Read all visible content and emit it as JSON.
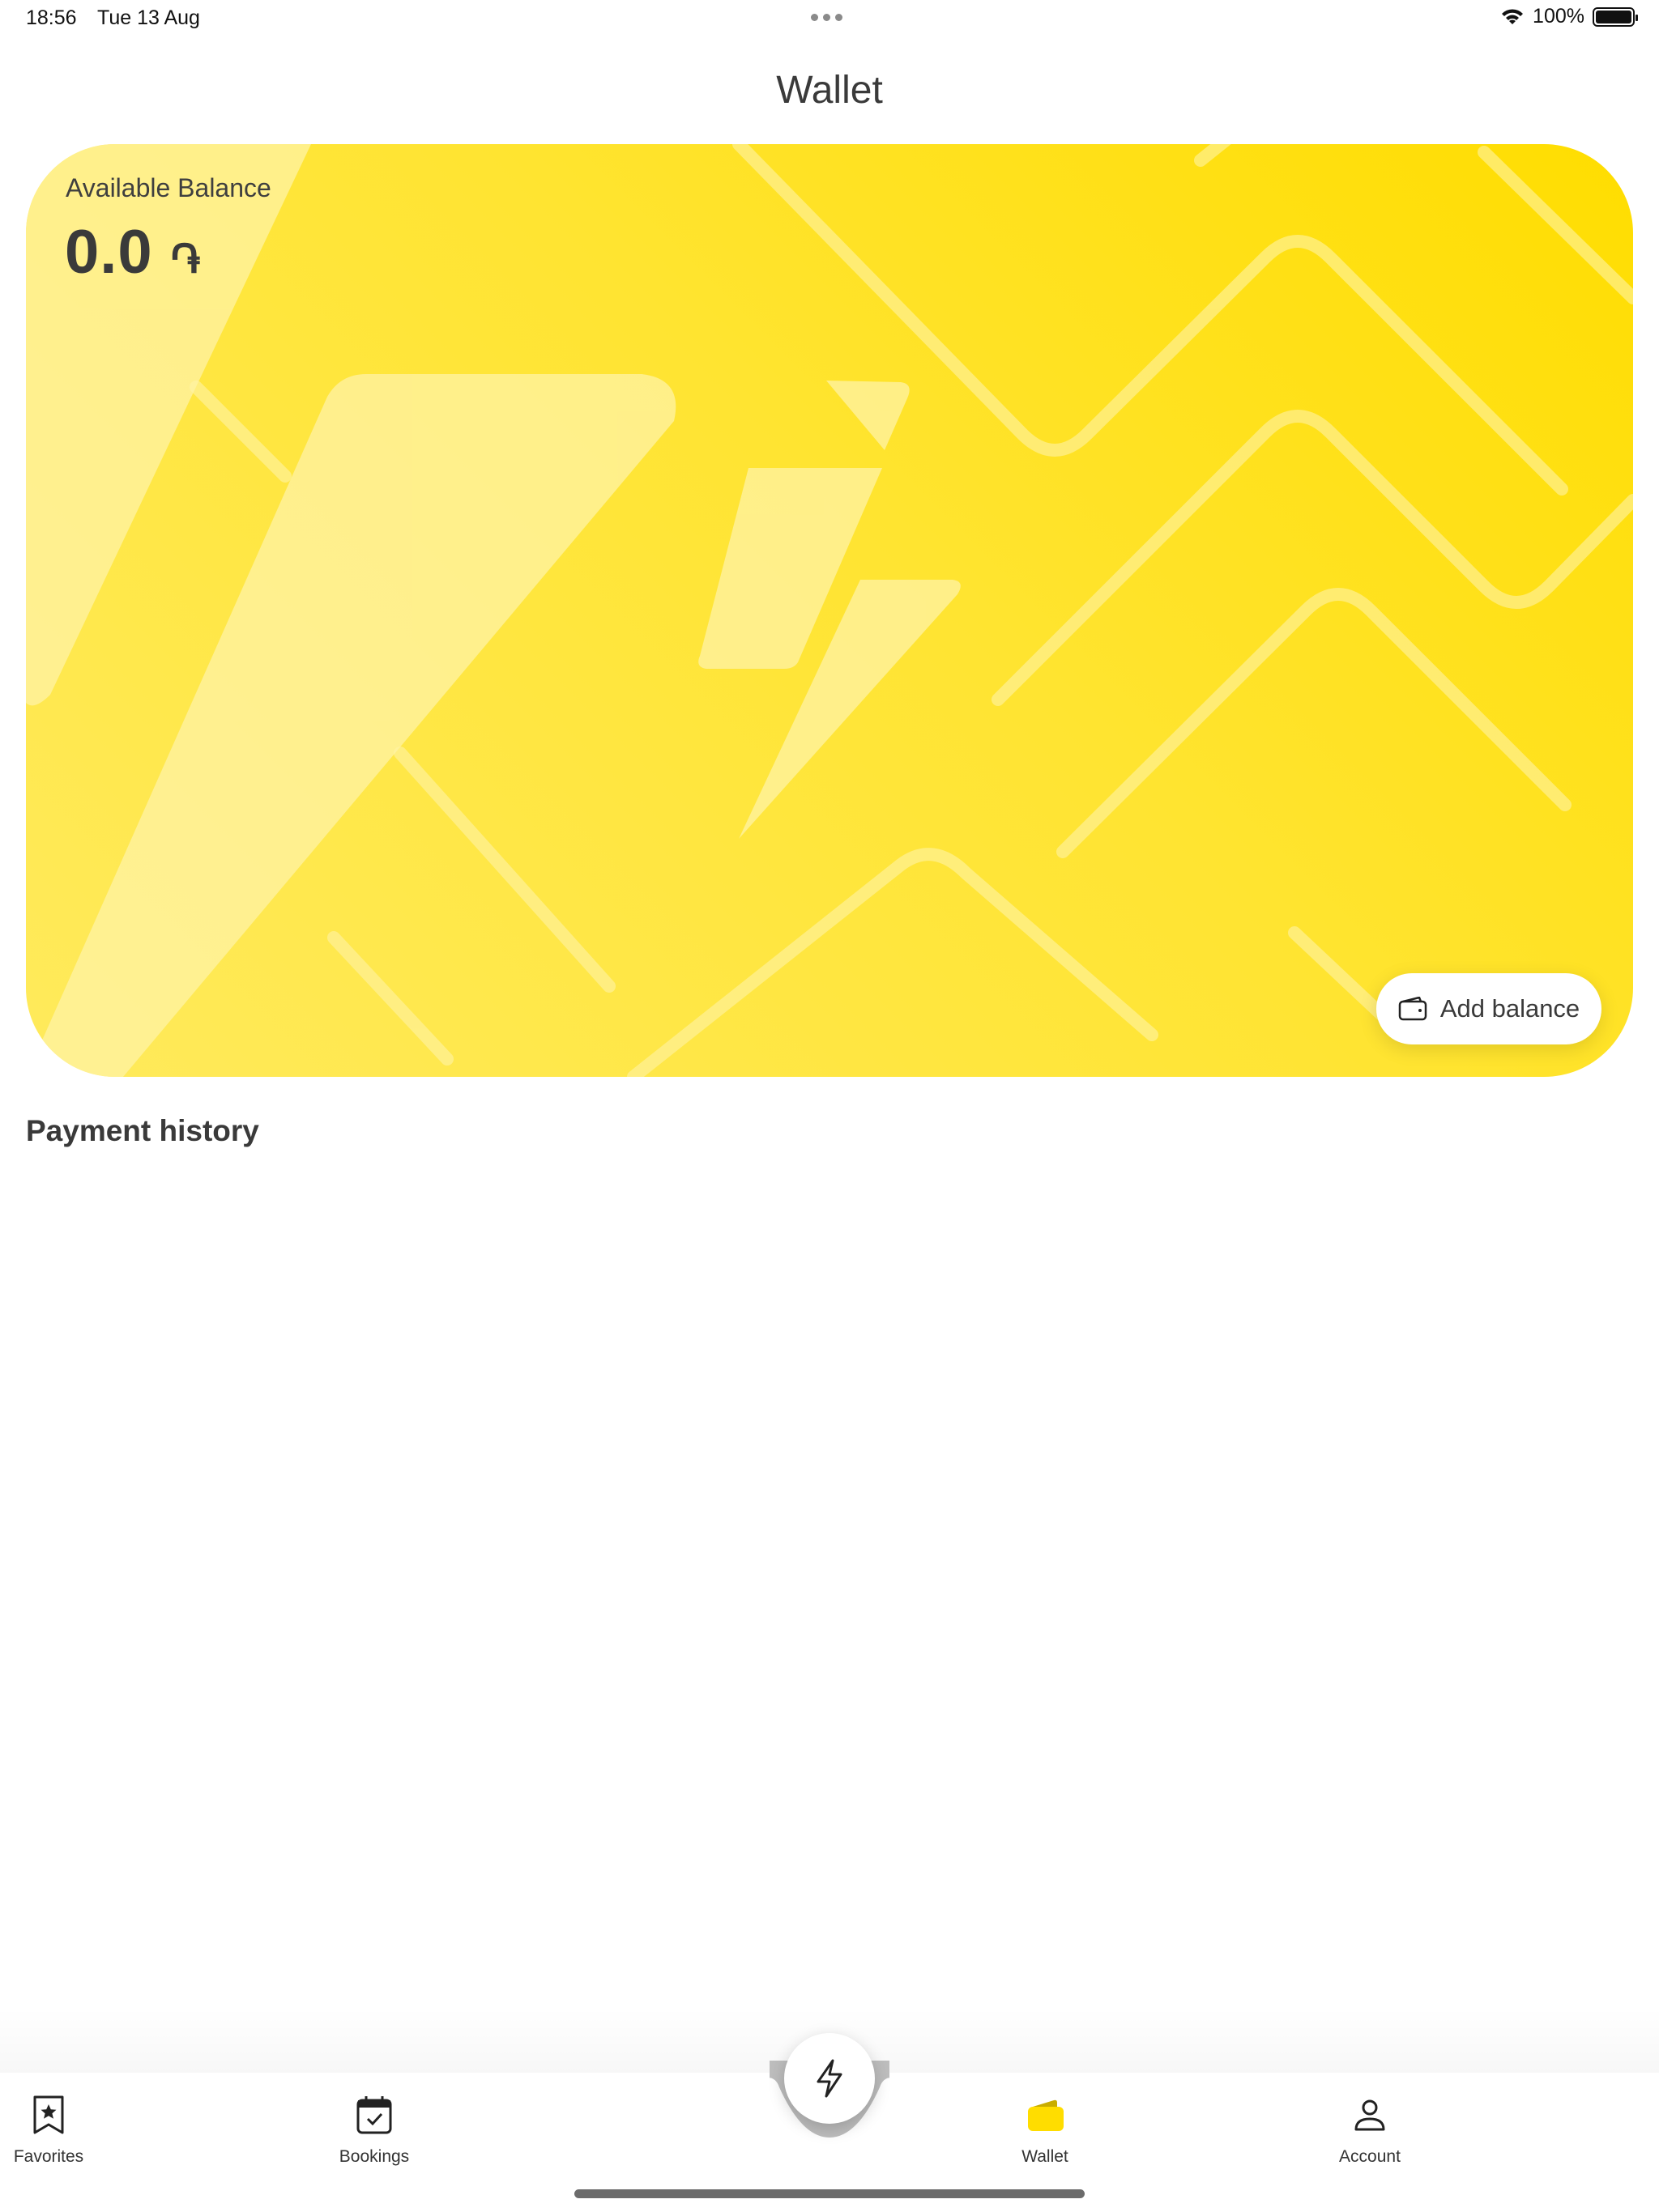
{
  "status_bar": {
    "time": "18:56",
    "date": "Tue 13 Aug",
    "battery": "100%"
  },
  "header": {
    "title": "Wallet"
  },
  "wallet_card": {
    "balance_label": "Available Balance",
    "balance_value": "0.0",
    "currency_symbol": "֏",
    "add_balance_label": "Add balance",
    "colors": {
      "card_start": "#ffea5c",
      "card_end": "#ffdd00",
      "pattern": "#fff3a6"
    }
  },
  "payment_history": {
    "title": "Payment history"
  },
  "tab_bar": {
    "items": [
      {
        "label": "Favorites",
        "icon": "bookmark-star-icon"
      },
      {
        "label": "Bookings",
        "icon": "calendar-check-icon"
      },
      {
        "label": "Wallet",
        "icon": "wallet-icon",
        "active": true
      },
      {
        "label": "Account",
        "icon": "user-icon"
      }
    ],
    "center_action_icon": "lightning-icon",
    "accent": "#ffdd00"
  }
}
